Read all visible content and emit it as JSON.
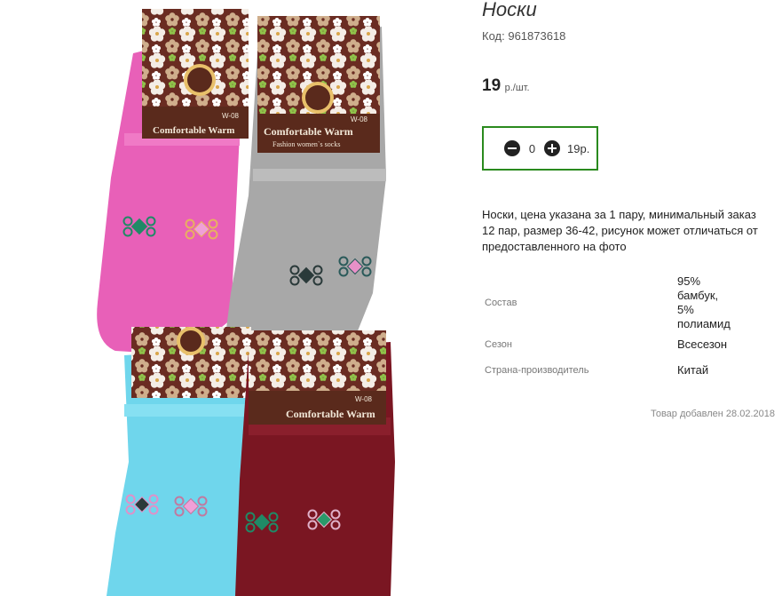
{
  "product": {
    "title": "Носки",
    "code_label": "Код:",
    "code": "961873618",
    "price": "19",
    "price_unit": "р./шт.",
    "quantity": "0",
    "sum": "19р.",
    "description": "Носки, цена указана за 1 пару, минимальный заказ 12 пар, размер 36-42, рисунок может отличаться от предоставленного на фото",
    "added": "Товар добавлен 28.02.2018"
  },
  "properties": [
    {
      "label": "Состав",
      "value_lines": [
        "95%",
        "бамбук,",
        "5%",
        "полиамид"
      ]
    },
    {
      "label": "Сезон",
      "value": "Всесезон"
    },
    {
      "label": "Страна-производитель",
      "value": "Китай"
    }
  ],
  "photo": {
    "label_brand": "Comfortable Warm",
    "label_sub": "Fashion women`s socks",
    "label_model": "W-08",
    "colors": {
      "pink": "#e860b8",
      "gray": "#a8a8a8",
      "blue": "#6fd6ec",
      "burgundy": "#7a1622",
      "header": "#5a2a1c",
      "accent": "#2a8a1e"
    }
  }
}
